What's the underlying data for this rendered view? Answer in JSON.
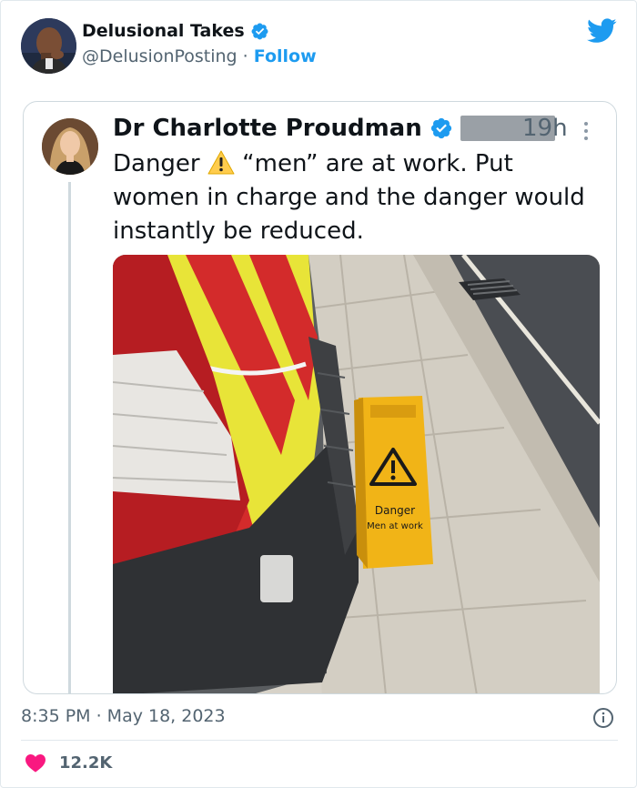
{
  "tweet": {
    "author_name": "Delusional Takes",
    "handle": "@DelusionPosting",
    "separator": "·",
    "follow_label": "Follow",
    "timestamp": "8:35 PM · May 18, 2023",
    "likes": "12.2K"
  },
  "quoted": {
    "author_name": "Dr Charlotte Proudman",
    "time": "19h",
    "text_before": "Danger ",
    "text_after": " “men” are at work. Put women in charge and the danger would instantly be reduced."
  },
  "photo": {
    "sign_line1": "Danger",
    "sign_line2": "Men at work"
  },
  "colors": {
    "accent": "#1d9bf0",
    "like": "#f91880",
    "muted": "#536471"
  },
  "icons": [
    "verified-badge-icon",
    "twitter-bird-icon",
    "more-icon",
    "warning-icon",
    "info-icon",
    "heart-icon"
  ]
}
